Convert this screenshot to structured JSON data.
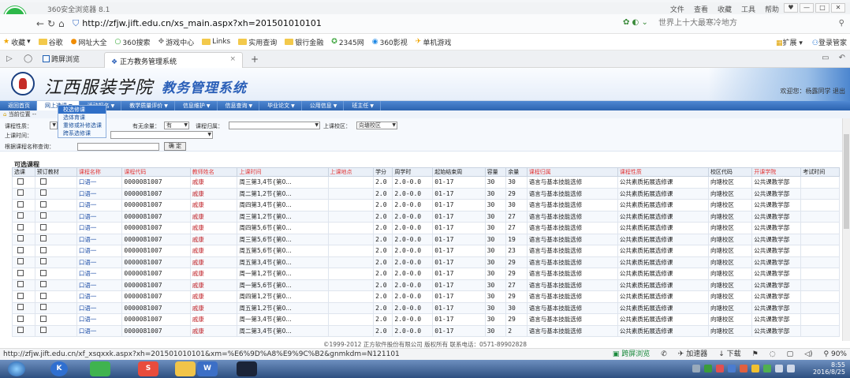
{
  "browser": {
    "title": "360安全浏览器 8.1",
    "title_menu": [
      "文件",
      "查看",
      "收藏",
      "工具",
      "帮助"
    ],
    "url": "http://zfjw.jift.edu.cn/xs_main.aspx?xh=201501010101",
    "search_text": "世界上十大最寒冷地方",
    "bookmarks": [
      "收藏",
      "谷歌",
      "网址大全",
      "360搜索",
      "游戏中心",
      "Links",
      "实用查询",
      "银行金融",
      "2345网",
      "360影视",
      "单机游戏"
    ],
    "bookmarks_right": [
      "扩展",
      "登录管家"
    ],
    "tab_mode": "跨屏浏览",
    "tab_title": "正方教务管理系统",
    "status_url": "http://zfjw.jift.edu.cn/xf_xsqxxk.aspx?xh=201501010101&xm=%E6%9D%A8%E9%9C%B2&gnmkdm=N121101",
    "status_right": [
      "跨屏浏览",
      "加速器",
      "下载",
      "90%"
    ]
  },
  "header": {
    "school": "江西服装学院",
    "system": "教务管理系统",
    "welcome": "欢迎您：杨露同学  退出"
  },
  "menu": [
    "返回首页",
    "网上选课",
    "活动报名",
    "教学质量评价",
    "信息维护",
    "信息查询",
    "毕业论文",
    "公用信息",
    "班主任"
  ],
  "submenu": [
    "校选修课",
    "选体育课",
    "重修或补修选课",
    "跨系选修课"
  ],
  "breadcrumb": "当前位置 --",
  "filters": {
    "course_nature_label": "课程性质：",
    "remaining_label": "有无余量：",
    "remaining_value": "有",
    "belong_label": "课程归属：",
    "campus_label": "上课校区：",
    "campus_value": "向塘校区",
    "time_label": "上课时间：",
    "name_search_label": "根据课程名称查询：",
    "ok_button": "确 定"
  },
  "table": {
    "section_title": "可选课程",
    "headers": [
      "选课",
      "预订教材",
      "课程名称",
      "课程代码",
      "教师姓名",
      "上课时间",
      "上课地点",
      "学分",
      "周学时",
      "起始结束周",
      "容量",
      "余量",
      "课程归属",
      "课程性质",
      "校区代码",
      "开课学院",
      "考试时间"
    ],
    "rows": [
      [
        "口语一",
        "0000081007",
        "戚康",
        "周三第3,4节{第0...",
        "2.0",
        "2.0-0.0",
        "01-17",
        "30",
        "30",
        "语言与基本技能选修",
        "公共素质拓展选修课",
        "向塘校区",
        "公共课教学部"
      ],
      [
        "口语一",
        "0000081007",
        "戚康",
        "周二第1,2节{第0...",
        "2.0",
        "2.0-0.0",
        "01-17",
        "30",
        "29",
        "语言与基本技能选修",
        "公共素质拓展选修课",
        "向塘校区",
        "公共课教学部"
      ],
      [
        "口语一",
        "0000081007",
        "戚康",
        "周四第3,4节{第0...",
        "2.0",
        "2.0-0.0",
        "01-17",
        "30",
        "30",
        "语言与基本技能选修",
        "公共素质拓展选修课",
        "向塘校区",
        "公共课教学部"
      ],
      [
        "口语一",
        "0000081007",
        "戚康",
        "周三第1,2节{第0...",
        "2.0",
        "2.0-0.0",
        "01-17",
        "30",
        "27",
        "语言与基本技能选修",
        "公共素质拓展选修课",
        "向塘校区",
        "公共课教学部"
      ],
      [
        "口语一",
        "0000081007",
        "戚康",
        "周四第5,6节{第0...",
        "2.0",
        "2.0-0.0",
        "01-17",
        "30",
        "27",
        "语言与基本技能选修",
        "公共素质拓展选修课",
        "向塘校区",
        "公共课教学部"
      ],
      [
        "口语一",
        "0000081007",
        "戚康",
        "周三第5,6节{第0...",
        "2.0",
        "2.0-0.0",
        "01-17",
        "30",
        "19",
        "语言与基本技能选修",
        "公共素质拓展选修课",
        "向塘校区",
        "公共课教学部"
      ],
      [
        "口语一",
        "0000081007",
        "戚康",
        "周五第5,6节{第0...",
        "2.0",
        "2.0-0.0",
        "01-17",
        "30",
        "23",
        "语言与基本技能选修",
        "公共素质拓展选修课",
        "向塘校区",
        "公共课教学部"
      ],
      [
        "口语一",
        "0000081007",
        "戚康",
        "周五第3,4节{第0...",
        "2.0",
        "2.0-0.0",
        "01-17",
        "30",
        "29",
        "语言与基本技能选修",
        "公共素质拓展选修课",
        "向塘校区",
        "公共课教学部"
      ],
      [
        "口语一",
        "0000081007",
        "戚康",
        "周一第1,2节{第0...",
        "2.0",
        "2.0-0.0",
        "01-17",
        "30",
        "29",
        "语言与基本技能选修",
        "公共素质拓展选修课",
        "向塘校区",
        "公共课教学部"
      ],
      [
        "口语一",
        "0000081007",
        "戚康",
        "周一第5,6节{第0...",
        "2.0",
        "2.0-0.0",
        "01-17",
        "30",
        "27",
        "语言与基本技能选修",
        "公共素质拓展选修课",
        "向塘校区",
        "公共课教学部"
      ],
      [
        "口语一",
        "0000081007",
        "戚康",
        "周四第1,2节{第0...",
        "2.0",
        "2.0-0.0",
        "01-17",
        "30",
        "29",
        "语言与基本技能选修",
        "公共素质拓展选修课",
        "向塘校区",
        "公共课教学部"
      ],
      [
        "口语一",
        "0000081007",
        "戚康",
        "周五第1,2节{第0...",
        "2.0",
        "2.0-0.0",
        "01-17",
        "30",
        "30",
        "语言与基本技能选修",
        "公共素质拓展选修课",
        "向塘校区",
        "公共课教学部"
      ],
      [
        "口语一",
        "0000081007",
        "戚康",
        "周一第3,4节{第0...",
        "2.0",
        "2.0-0.0",
        "01-17",
        "30",
        "29",
        "语言与基本技能选修",
        "公共素质拓展选修课",
        "向塘校区",
        "公共课教学部"
      ],
      [
        "口语一",
        "0000081007",
        "戚康",
        "周二第3,4节{第0...",
        "2.0",
        "2.0-0.0",
        "01-17",
        "30",
        "2",
        "语言与基本技能选修",
        "公共素质拓展选修课",
        "向塘校区",
        "公共课教学部"
      ]
    ]
  },
  "footer": "©1999-2012  正方软件股份有限公司 版权所有  联系电话：0571-89902828",
  "taskbar": {
    "time": "8:55",
    "date": "2016/8/25"
  }
}
